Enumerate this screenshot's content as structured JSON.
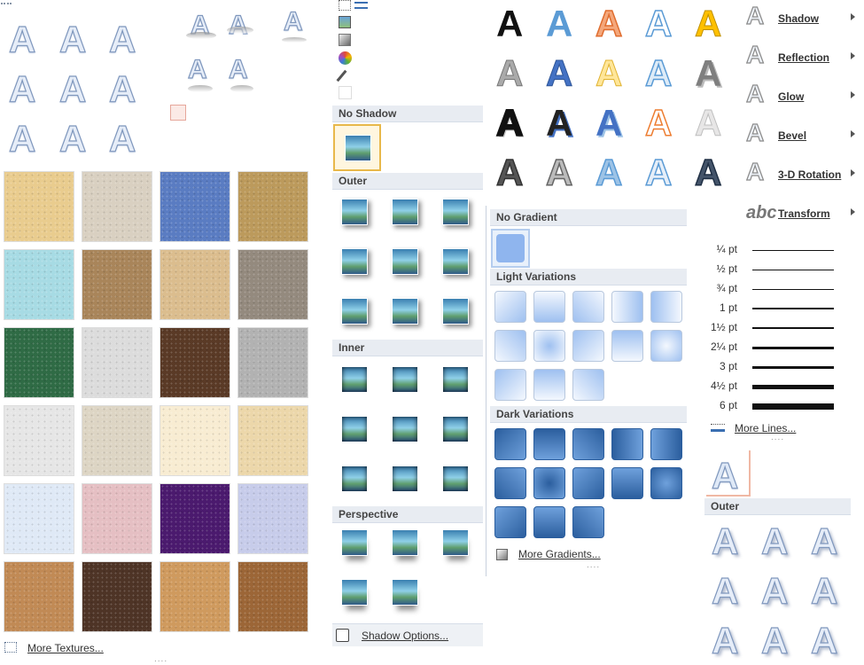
{
  "textures_panel": {
    "more_textures_label": "More Textures...",
    "textures": [
      {
        "name": "papyrus",
        "color": "#e9cc8e"
      },
      {
        "name": "canvas",
        "color": "#d9d0c1"
      },
      {
        "name": "denim",
        "color": "#5a7cc2"
      },
      {
        "name": "woven-mat",
        "color": "#bc9a5c"
      },
      {
        "name": "water-droplets",
        "color": "#a7dbe4"
      },
      {
        "name": "crumpled-paper",
        "color": "#a9855a"
      },
      {
        "name": "fish-fossil",
        "color": "#dbbd8e"
      },
      {
        "name": "granite",
        "color": "#948a7e"
      },
      {
        "name": "green-marble",
        "color": "#2f6b45"
      },
      {
        "name": "white-marble",
        "color": "#dcdcdc"
      },
      {
        "name": "brown-marble",
        "color": "#5a3a26"
      },
      {
        "name": "gray-granite",
        "color": "#b2b2b2"
      },
      {
        "name": "recycled-paper",
        "color": "#e6e6e6"
      },
      {
        "name": "parchment",
        "color": "#ddd5c4"
      },
      {
        "name": "stationery",
        "color": "#f8ecd2"
      },
      {
        "name": "sand",
        "color": "#ecd7aa"
      },
      {
        "name": "blue-tissue-paper",
        "color": "#dfe9f6"
      },
      {
        "name": "pink-tissue-paper",
        "color": "#e5bfc3"
      },
      {
        "name": "purple-mesh",
        "color": "#4b1a6e"
      },
      {
        "name": "bouquet",
        "color": "#c7ccea"
      },
      {
        "name": "cork",
        "color": "#c18a55"
      },
      {
        "name": "walnut",
        "color": "#4e3426"
      },
      {
        "name": "oak",
        "color": "#cf9a5e"
      },
      {
        "name": "medium-wood",
        "color": "#9c6637"
      }
    ]
  },
  "shadow_panel": {
    "no_shadow_label": "No Shadow",
    "outer_label": "Outer",
    "inner_label": "Inner",
    "perspective_label": "Perspective",
    "shadow_options_label": "Shadow Options..."
  },
  "gradient_panel": {
    "no_gradient_label": "No Gradient",
    "light_variations_label": "Light Variations",
    "dark_variations_label": "Dark Variations",
    "more_gradients_label": "More Gradients...",
    "accent": "#7aa7e6"
  },
  "effects_menu": {
    "items": [
      {
        "icon": "A",
        "label": "Shadow"
      },
      {
        "icon": "A",
        "label": "Reflection"
      },
      {
        "icon": "A",
        "label": "Glow"
      },
      {
        "icon": "A",
        "label": "Bevel"
      },
      {
        "icon": "A",
        "label": "3-D Rotation"
      },
      {
        "icon": "abc",
        "label": "Transform"
      }
    ]
  },
  "line_weights": {
    "items": [
      "¼ pt",
      "½ pt",
      "¾ pt",
      "1 pt",
      "1½ pt",
      "2¼ pt",
      "3 pt",
      "4½ pt",
      "6 pt"
    ],
    "more_lines_label": "More Lines..."
  },
  "outer_shadow_panel": {
    "header_label": "Outer"
  },
  "wordart_letter": "A"
}
